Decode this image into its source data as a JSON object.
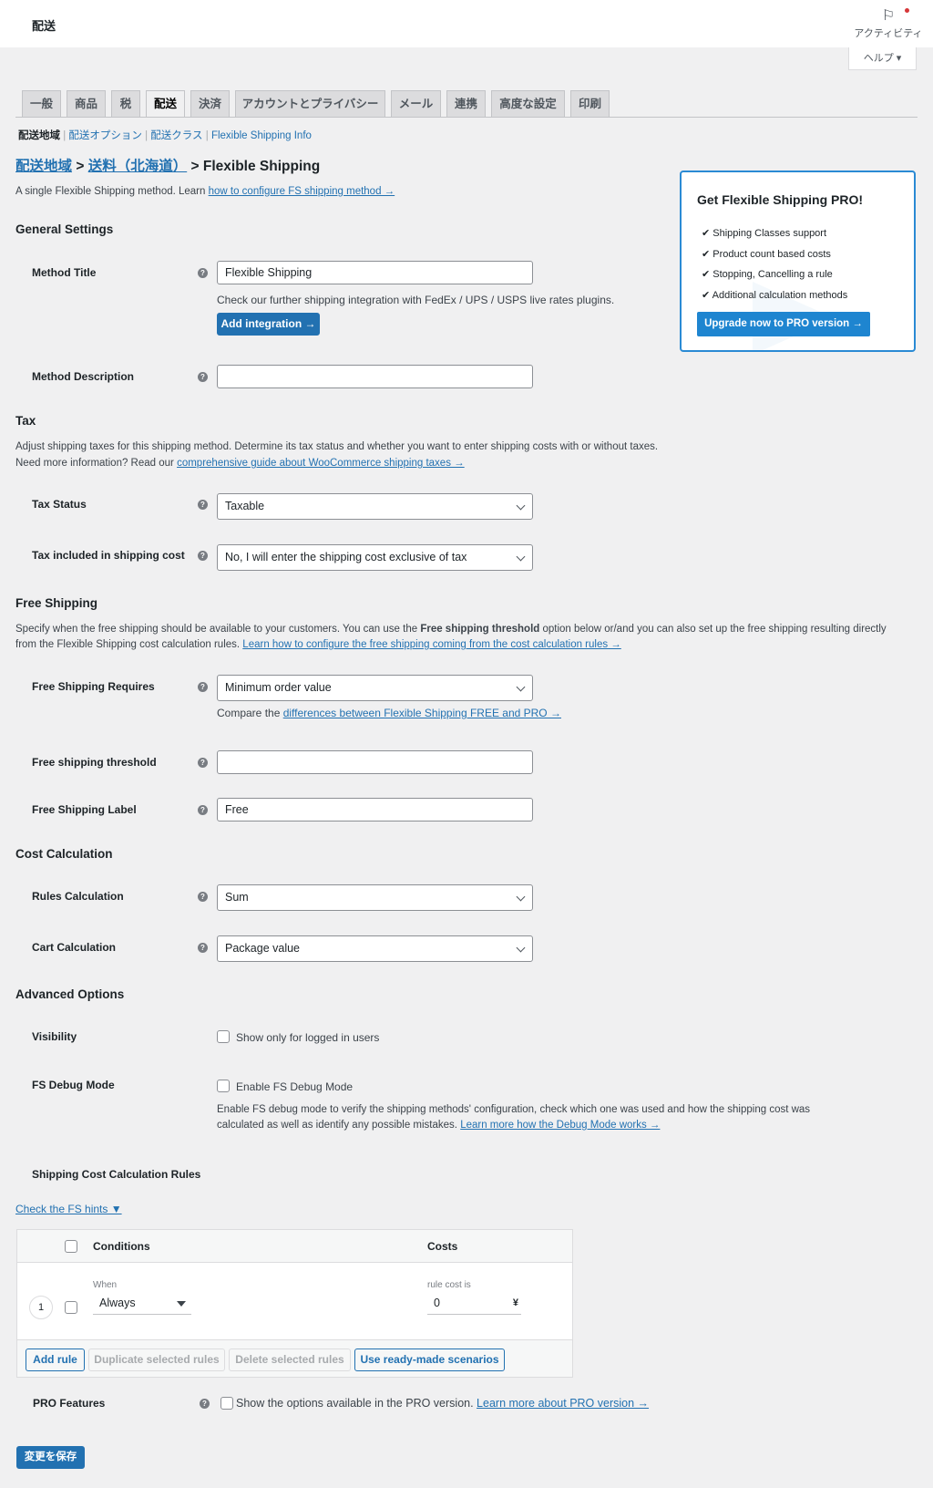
{
  "header": {
    "title": "配送",
    "activity_label": "アクティビティ",
    "help_label": "ヘルプ ▾"
  },
  "tabs": [
    "一般",
    "商品",
    "税",
    "配送",
    "決済",
    "アカウントとプライバシー",
    "メール",
    "連携",
    "高度な設定",
    "印刷"
  ],
  "active_tab": "配送",
  "subnav": {
    "current": "配送地域",
    "items": [
      "配送オプション",
      "配送クラス",
      "Flexible Shipping Info"
    ]
  },
  "breadcrumb": {
    "zone": "配送地域",
    "sep1": " > ",
    "method": "送料（北海道）",
    "sep2": " > ",
    "current": "Flexible Shipping"
  },
  "intro": {
    "text": "A single Flexible Shipping method. Learn ",
    "link": "how to configure FS shipping method →"
  },
  "general": {
    "title": "General Settings",
    "method_title_label": "Method Title",
    "method_title_value": "Flexible Shipping",
    "integration_note": "Check our further shipping integration with FedEx / UPS / USPS live rates plugins.",
    "add_integration": "Add integration →",
    "method_description_label": "Method Description",
    "method_description_value": ""
  },
  "tax": {
    "title": "Tax",
    "line1": "Adjust shipping taxes for this shipping method. Determine its tax status and whether you want to enter shipping costs with or without taxes.",
    "line2": "Need more information? Read our ",
    "line2_link": "comprehensive guide about WooCommerce shipping taxes →",
    "status_label": "Tax Status",
    "status_value": "Taxable",
    "included_label": "Tax included in shipping cost",
    "included_value": "No, I will enter the shipping cost exclusive of tax"
  },
  "free": {
    "title": "Free Shipping",
    "text1": "Specify when the free shipping should be available to your customers. You can use the ",
    "text_bold": "Free shipping threshold",
    "text2": " option below or/and you can also set up the free shipping resulting directly",
    "text3": "from the Flexible Shipping cost calculation rules. ",
    "link": "Learn how to configure the free shipping coming from the cost calculation rules →",
    "requires_label": "Free Shipping Requires",
    "requires_value": "Minimum order value",
    "compare_text": "Compare the ",
    "compare_link": "differences between Flexible Shipping FREE and PRO →",
    "threshold_label": "Free shipping threshold",
    "threshold_value": "",
    "label_label": "Free Shipping Label",
    "label_value": "Free"
  },
  "cost": {
    "title": "Cost Calculation",
    "rules_label": "Rules Calculation",
    "rules_value": "Sum",
    "cart_label": "Cart Calculation",
    "cart_value": "Package value"
  },
  "advanced": {
    "title": "Advanced Options",
    "visibility_label": "Visibility",
    "visibility_option": "Show only for logged in users",
    "debug_label": "FS Debug Mode",
    "debug_option": "Enable FS Debug Mode",
    "debug_text1": "Enable FS debug mode to verify the shipping methods' configuration, check which one was used and how the shipping cost was",
    "debug_text2": "calculated as well as identify any possible mistakes. ",
    "debug_link": "Learn more how the Debug Mode works →"
  },
  "rules": {
    "title": "Shipping Cost Calculation Rules",
    "hints": "Check the FS hints ▼",
    "col_conditions": "Conditions",
    "col_costs": "Costs",
    "row": {
      "number": "1",
      "when_label": "When",
      "when_value": "Always",
      "cost_label": "rule cost is",
      "cost_value": "0",
      "currency": "¥"
    },
    "add": "Add rule",
    "duplicate": "Duplicate selected rules",
    "delete": "Delete selected rules",
    "scenarios": "Use ready-made scenarios"
  },
  "pro": {
    "label": "PRO Features",
    "option": "Show the options available in the PRO version. ",
    "link": "Learn more about PRO version →"
  },
  "save": "変更を保存",
  "promo": {
    "title": "Get Flexible Shipping PRO!",
    "items": [
      "Shipping Classes support",
      "Product count based costs",
      "Stopping, Cancelling a rule",
      "Additional calculation methods"
    ],
    "button": "Upgrade now to PRO version →"
  },
  "colors": {
    "accent": "#2271b1",
    "promo_border": "#2a8ad4",
    "promo_button": "#1e85d0"
  }
}
